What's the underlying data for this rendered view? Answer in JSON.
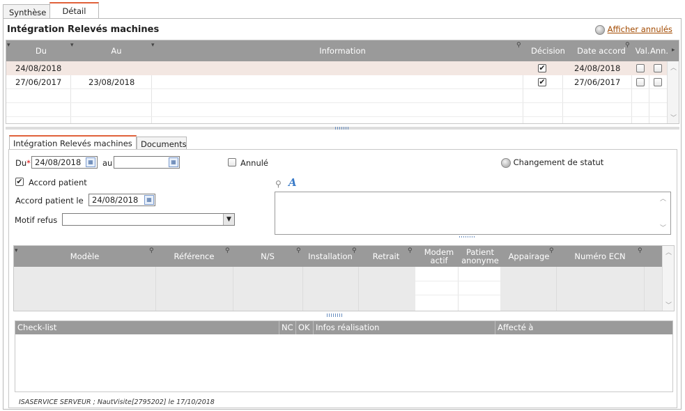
{
  "tabs": {
    "synthese": "Synthèse",
    "detail": "Détail"
  },
  "header": {
    "title": "Intégration Relevés machines",
    "show_cancelled": "Afficher annulés"
  },
  "grid1": {
    "columns": {
      "du": "Du",
      "au": "Au",
      "information": "Information",
      "decision": "Décision",
      "date_accord": "Date accord",
      "val": "Val.",
      "ann": "Ann."
    },
    "rows": [
      {
        "du": "24/08/2018",
        "au": "",
        "information": "",
        "decision": true,
        "date_accord": "24/08/2018",
        "val": false,
        "ann": false
      },
      {
        "du": "27/06/2017",
        "au": "23/08/2018",
        "information": "",
        "decision": true,
        "date_accord": "27/06/2017",
        "val": false,
        "ann": false
      }
    ]
  },
  "subtabs": {
    "integration": "Intégration Relevés machines",
    "documents": "Documents"
  },
  "form": {
    "du_label": "Du",
    "du_required": "*",
    "du_value": "24/08/2018",
    "au_label": "au",
    "au_value": "",
    "annule_label": "Annulé",
    "changement_statut": "Changement de statut",
    "accord_patient_label": "Accord patient",
    "accord_patient_checked": true,
    "accord_patient_le_label": "Accord patient le",
    "accord_patient_le_value": "24/08/2018",
    "motif_refus_label": "Motif refus",
    "motif_refus_value": ""
  },
  "grid2": {
    "columns": {
      "modele": "Modèle",
      "reference": "Référence",
      "ns": "N/S",
      "installation": "Installation",
      "retrait": "Retrait",
      "modem_actif": "Modem actif",
      "patient_anonyme": "Patient anonyme",
      "appairage": "Appairage",
      "numero_ecn": "Numéro ECN"
    }
  },
  "grid3": {
    "columns": {
      "checklist": "Check-list",
      "nc": "NC",
      "ok": "OK",
      "infos": "Infos réalisation",
      "affecte": "Affecté à"
    }
  },
  "footer": {
    "text": "ISASERVICE SERVEUR ; NautVisite[2795202] le 17/10/2018"
  },
  "colors": {
    "accent": "#e0613a",
    "header_gray": "#9a9a9a",
    "selected_row": "#f3e7e2",
    "link": "#a24a00"
  }
}
